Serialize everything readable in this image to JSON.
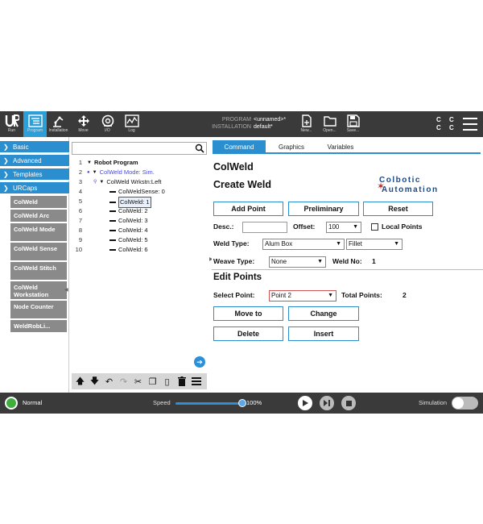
{
  "header": {
    "nav": [
      {
        "label": "Run",
        "icon": "ur-logo-icon"
      },
      {
        "label": "Program",
        "icon": "program-icon"
      },
      {
        "label": "Installation",
        "icon": "installation-icon"
      },
      {
        "label": "Move",
        "icon": "move-icon"
      },
      {
        "label": "I/O",
        "icon": "io-icon"
      },
      {
        "label": "Log",
        "icon": "log-icon"
      }
    ],
    "program_key": "PROGRAM",
    "program_value": "<unnamed>*",
    "installation_key": "INSTALLATION",
    "installation_value": "default*",
    "file_buttons": [
      {
        "label": "New...",
        "icon": "new-file-icon"
      },
      {
        "label": "Open...",
        "icon": "open-folder-icon"
      },
      {
        "label": "Save...",
        "icon": "save-icon"
      }
    ],
    "cc_icon_text": "C C\nC C"
  },
  "left_nav": {
    "sections": [
      {
        "label": "Basic",
        "expanded": false
      },
      {
        "label": "Advanced",
        "expanded": false
      },
      {
        "label": "Templates",
        "expanded": false
      },
      {
        "label": "URCaps",
        "expanded": true
      }
    ],
    "urcaps_items": [
      "ColWeld",
      "ColWeld Arc",
      "ColWeld Mode",
      "ColWeld Sense",
      "ColWeld Stitch",
      "ColWeld Workstation",
      "Node Counter",
      "WeldRobLi..."
    ]
  },
  "tree": {
    "search_value": "",
    "rows": [
      {
        "num": "1",
        "text": "Robot Program"
      },
      {
        "num": "2",
        "text": "ColWeld Mode: Sim."
      },
      {
        "num": "3",
        "text": "ColWeld Wrkstn:Left"
      },
      {
        "num": "4",
        "text": "ColWeldSense: 0"
      },
      {
        "num": "5",
        "text": "ColWeld: 1"
      },
      {
        "num": "6",
        "text": "ColWeld: 2"
      },
      {
        "num": "7",
        "text": "ColWeld: 3"
      },
      {
        "num": "8",
        "text": "ColWeld: 4"
      },
      {
        "num": "9",
        "text": "ColWeld: 5"
      },
      {
        "num": "10",
        "text": "ColWeld: 6"
      }
    ],
    "selected_row": "5"
  },
  "tabs": [
    "Command",
    "Graphics",
    "Variables"
  ],
  "active_tab": "Command",
  "command": {
    "title": "ColWeld",
    "create_title": "Create Weld",
    "logo_line1": "Colbotic",
    "logo_line2": "Automation",
    "buttons": {
      "add_point": "Add Point",
      "preliminary": "Preliminary",
      "reset": "Reset"
    },
    "desc_label": "Desc.:",
    "desc_value": "",
    "offset_label": "Offset:",
    "offset_value": "100",
    "local_points_label": "Local Points",
    "local_points_checked": false,
    "weld_type_label": "Weld Type:",
    "weld_type_value": "Alum Box",
    "weld_shape_value": "Fillet",
    "weave_type_label": "Weave Type:",
    "weave_type_value": "None",
    "weld_no_label": "Weld No:",
    "weld_no_value": "1",
    "edit_title": "Edit Points",
    "select_point_label": "Select Point:",
    "select_point_value": "Point 2",
    "total_points_label": "Total Points:",
    "total_points_value": "2",
    "edit_buttons": {
      "move_to": "Move to",
      "change": "Change",
      "delete": "Delete",
      "insert": "Insert"
    }
  },
  "footer": {
    "status": "Normal",
    "status_color": "#3fae3f",
    "speed_label": "Speed",
    "speed_value": "100%",
    "speed_fraction": 1.0,
    "simulation_label": "Simulation",
    "simulation_on": false
  },
  "colors": {
    "accent": "#2b8fcf",
    "header_bg": "#3a3a3a"
  }
}
